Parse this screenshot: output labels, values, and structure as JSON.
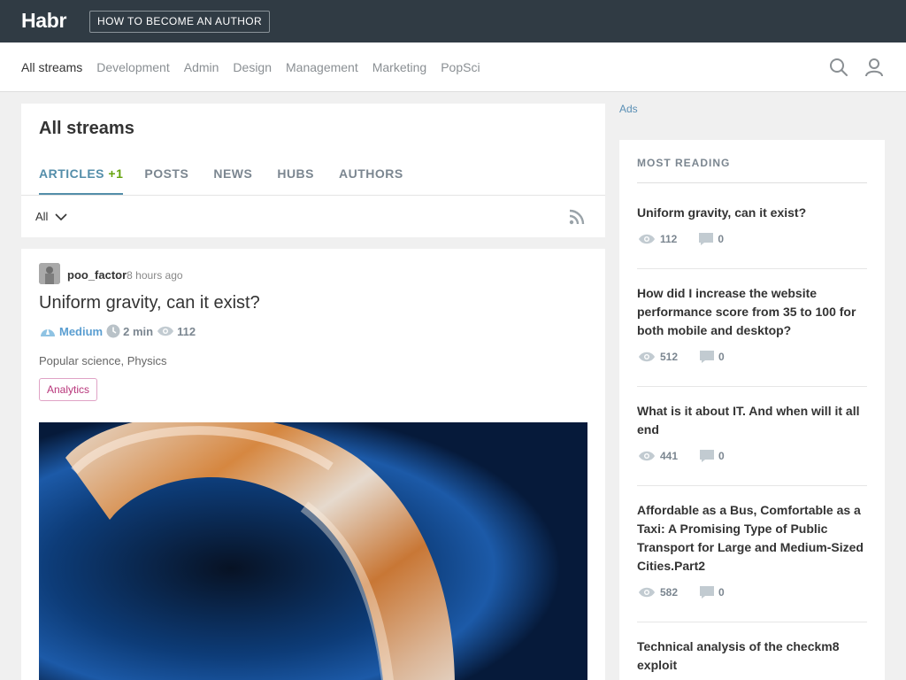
{
  "topbar": {
    "logo": "Habr",
    "author_button": "HOW TO BECOME AN AUTHOR"
  },
  "nav": {
    "items": [
      {
        "label": "All streams",
        "active": true
      },
      {
        "label": "Development"
      },
      {
        "label": "Admin"
      },
      {
        "label": "Design"
      },
      {
        "label": "Management"
      },
      {
        "label": "Marketing"
      },
      {
        "label": "PopSci"
      }
    ],
    "search_icon": "search-icon",
    "user_icon": "user-icon"
  },
  "header": {
    "title": "All streams",
    "tabs": [
      {
        "label": "ARTICLES",
        "count": "+1",
        "active": true
      },
      {
        "label": "POSTS"
      },
      {
        "label": "NEWS"
      },
      {
        "label": "HUBS"
      },
      {
        "label": "AUTHORS"
      }
    ],
    "filter_value": "All",
    "rss_icon": "rss-icon"
  },
  "article": {
    "author": "poo_factor",
    "time": "8 hours ago",
    "title": "Uniform gravity, can it exist?",
    "complexity": "Medium",
    "reading_time": "2 min",
    "views": "112",
    "hubs": "Popular science, Physics",
    "label": "Analytics"
  },
  "sidebar": {
    "ads": "Ads",
    "title": "MOST READING",
    "items": [
      {
        "title": "Uniform gravity, can it exist?",
        "views": "112",
        "comments": "0"
      },
      {
        "title": "How did I increase the website performance score from 35 to 100 for both mobile and desktop?",
        "views": "512",
        "comments": "0"
      },
      {
        "title": "What is it about IT. And when will it all end",
        "views": "441",
        "comments": "0"
      },
      {
        "title": "Affordable as a Bus, Comfortable as a Taxi: A Promising Type of Public Transport for Large and Medium-Sized Cities.Part2",
        "views": "582",
        "comments": "0"
      },
      {
        "title": "Technical analysis of the checkm8 exploit",
        "views": "",
        "comments": ""
      }
    ]
  },
  "colors": {
    "topbar": "#303b44",
    "accent": "#548eaa",
    "count_green": "#65a30d",
    "badge_pink": "#b8367b"
  }
}
